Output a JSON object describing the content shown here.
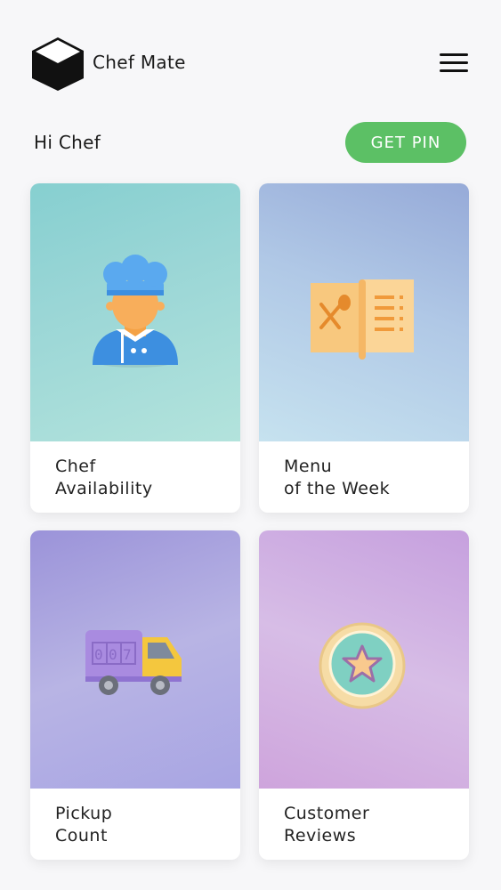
{
  "app": {
    "title": "Chef Mate"
  },
  "header": {
    "greeting": "Hi Chef",
    "pin_button": "GET PIN"
  },
  "icons": {
    "logo": "cube-logo-icon",
    "menu": "hamburger-menu-icon"
  },
  "cards": [
    {
      "line1": "Chef",
      "line2": "Availability",
      "icon": "chef-icon"
    },
    {
      "line1": "Menu",
      "line2": "of the Week",
      "icon": "menu-book-icon"
    },
    {
      "line1": "Pickup",
      "line2": "Count",
      "icon": "delivery-truck-icon"
    },
    {
      "line1": "Customer",
      "line2": "Reviews",
      "icon": "star-badge-icon"
    }
  ],
  "colors": {
    "accent": "#5cc065",
    "background": "#f7f7f9"
  }
}
